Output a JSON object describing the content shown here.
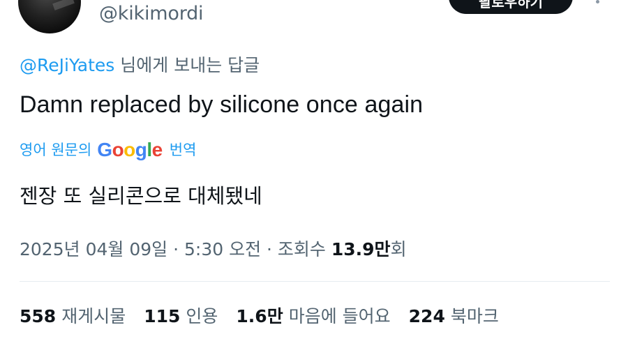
{
  "header": {
    "handle": "@kikimordi",
    "follow_label": "팔로우하기"
  },
  "reply": {
    "mention": "@ReJiYates",
    "suffix": " 님에게 보내는 답글"
  },
  "tweet": {
    "text": "Damn replaced by silicone once again"
  },
  "translation": {
    "prefix": "영어 원문의",
    "logo_letters": [
      "G",
      "o",
      "o",
      "g",
      "l",
      "e"
    ],
    "suffix": "번역",
    "text": "젠장 또 실리콘으로 대체됐네"
  },
  "meta": {
    "date": "2025년 04월 09일",
    "sep1": " · ",
    "time": "5:30 오전",
    "sep2": " · ",
    "views_label": "조회수 ",
    "views_count": "13.9만",
    "views_suffix": "회"
  },
  "stats": [
    {
      "num": "558",
      "label": "재게시물"
    },
    {
      "num": "115",
      "label": "인용"
    },
    {
      "num": "1.6만",
      "label": "마음에 들어요"
    },
    {
      "num": "224",
      "label": "북마크"
    }
  ],
  "colors": {
    "link": "#1d9bf0",
    "secondary_text": "#536471",
    "primary_text": "#0f1419"
  },
  "icons": {
    "more": "more-horizontal-icon"
  }
}
